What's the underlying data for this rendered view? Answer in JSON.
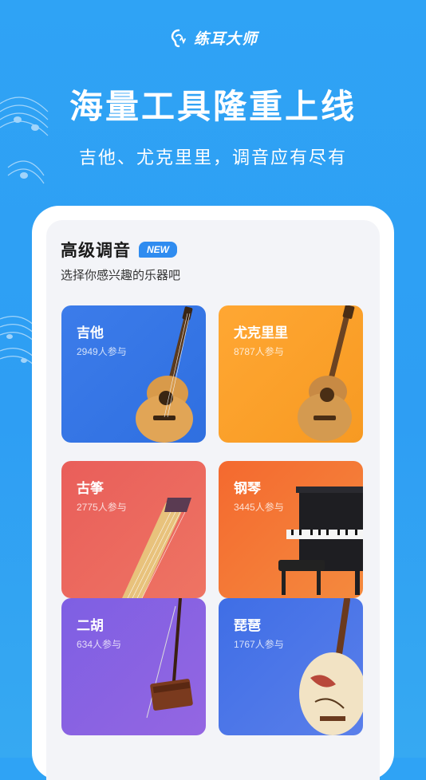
{
  "brand": {
    "name": "练耳大师",
    "logo_icon": "ear-music-icon"
  },
  "hero": {
    "title": "海量工具隆重上线",
    "subtitle": "吉他、尤克里里，调音应有尽有"
  },
  "section": {
    "title": "高级调音",
    "badge": "NEW",
    "subtitle": "选择你感兴趣的乐器吧"
  },
  "instruments": [
    {
      "name": "吉他",
      "count": "2949人参与",
      "color": "#3577E6",
      "icon": "guitar-icon"
    },
    {
      "name": "尤克里里",
      "count": "8787人参与",
      "color": "#FBA22E",
      "icon": "ukulele-icon"
    },
    {
      "name": "古筝",
      "count": "2775人参与",
      "color": "#EB6A5F",
      "icon": "guzheng-icon"
    },
    {
      "name": "钢琴",
      "count": "3445人参与",
      "color": "#F47A37",
      "icon": "piano-icon"
    },
    {
      "name": "二胡",
      "count": "634人参与",
      "color": "#8A62E2",
      "icon": "erhu-icon"
    },
    {
      "name": "琵琶",
      "count": "1767人参与",
      "color": "#4C77E8",
      "icon": "pipa-icon"
    }
  ]
}
